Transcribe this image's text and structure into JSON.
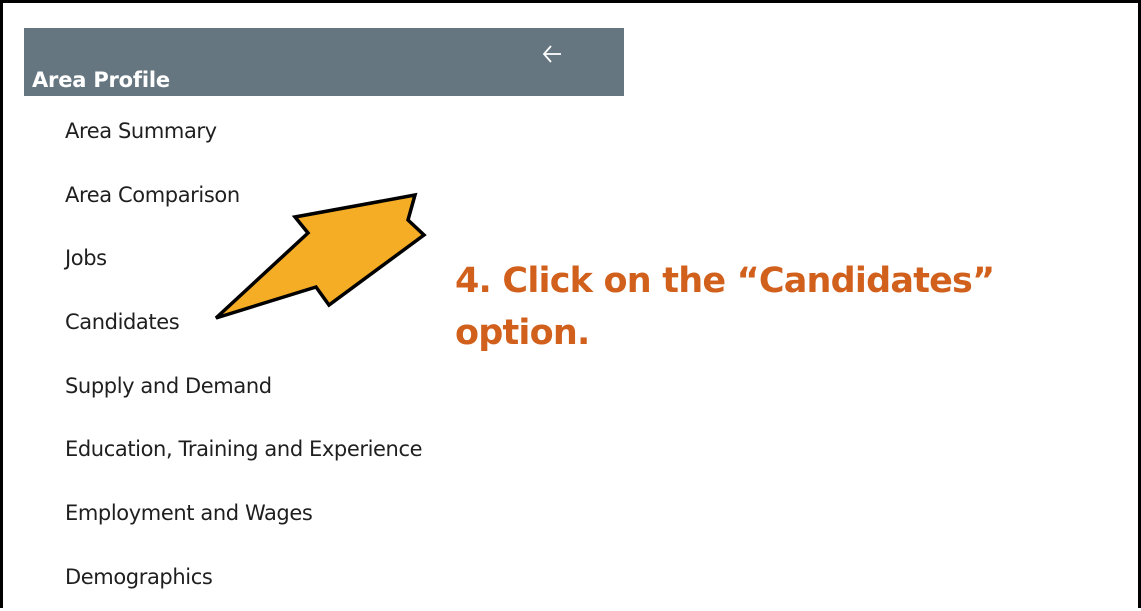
{
  "panel": {
    "title": "Area Profile",
    "back_icon": "arrow-left-icon",
    "header_color": "#657680"
  },
  "menu": {
    "items": [
      {
        "label": "Area Summary"
      },
      {
        "label": "Area Comparison"
      },
      {
        "label": "Jobs"
      },
      {
        "label": "Candidates"
      },
      {
        "label": "Supply and Demand"
      },
      {
        "label": "Education, Training and Experience"
      },
      {
        "label": "Employment and Wages"
      },
      {
        "label": "Demographics"
      }
    ]
  },
  "annotation": {
    "line1": "4. Click on the “Candidates”",
    "line2": "option.",
    "color": "#d2601d",
    "arrow_color": "#f5ad25"
  }
}
